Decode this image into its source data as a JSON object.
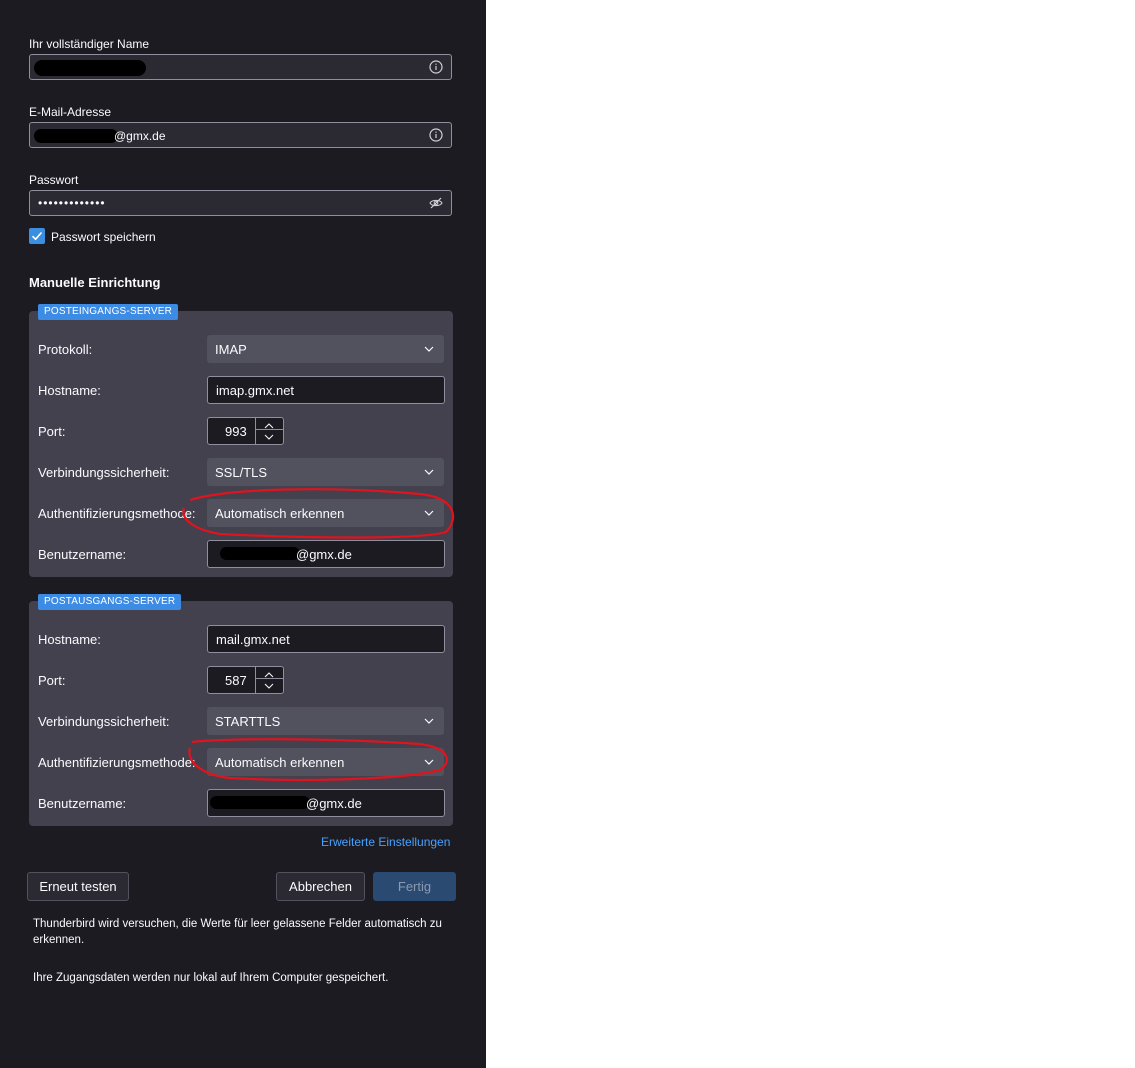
{
  "account": {
    "name_label": "Ihr vollständiger Name",
    "email_label": "E-Mail-Adresse",
    "email_value_suffix": "@gmx.de",
    "password_label": "Passwort",
    "password_value": "•••••••••••••",
    "save_password_label": "Passwort speichern",
    "save_password_checked": true
  },
  "manual": {
    "title": "Manuelle Einrichtung",
    "incoming": {
      "tag": "POSTEINGANGS-SERVER",
      "protocol_label": "Protokoll:",
      "protocol_value": "IMAP",
      "hostname_label": "Hostname:",
      "hostname_value": "imap.gmx.net",
      "port_label": "Port:",
      "port_value": "993",
      "security_label": "Verbindungssicherheit:",
      "security_value": "SSL/TLS",
      "auth_label": "Authentifizierungsmethode:",
      "auth_value": "Automatisch erkennen",
      "username_label": "Benutzername:",
      "username_suffix": "@gmx.de"
    },
    "outgoing": {
      "tag": "POSTAUSGANGS-SERVER",
      "hostname_label": "Hostname:",
      "hostname_value": "mail.gmx.net",
      "port_label": "Port:",
      "port_value": "587",
      "security_label": "Verbindungssicherheit:",
      "security_value": "STARTTLS",
      "auth_label": "Authentifizierungsmethode:",
      "auth_value": "Automatisch erkennen",
      "username_label": "Benutzername:",
      "username_suffix": "@gmx.de"
    },
    "advanced_link": "Erweiterte Einstellungen"
  },
  "buttons": {
    "retest": "Erneut testen",
    "cancel": "Abbrechen",
    "done": "Fertig"
  },
  "notes": {
    "autodetect": "Thunderbird wird versuchen, die Werte für leer gelassene Felder automatisch zu erkennen.",
    "local": "Ihre Zugangsdaten werden nur lokal auf Ihrem Computer gespeichert."
  },
  "colors": {
    "panel_bg": "#1c1b22",
    "accent": "#3c8be4",
    "link": "#45a1ff",
    "annotation": "#e0141e"
  },
  "icons": [
    "info-icon",
    "eye-slash-icon",
    "checkmark-icon",
    "chevron-down-icon",
    "chevron-up-icon"
  ]
}
